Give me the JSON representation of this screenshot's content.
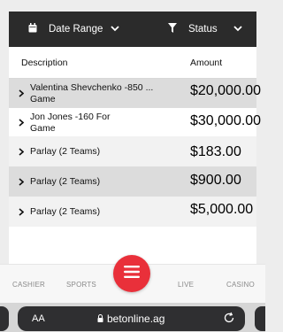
{
  "filters": {
    "date_range_label": "Date Range",
    "status_label": "Status",
    "calendar_icon": "calendar-icon",
    "filter_icon": "filter-icon"
  },
  "table": {
    "header_description": "Description",
    "header_amount": "Amount",
    "rows": [
      {
        "description": "Valentina Shevchenko -850 ...",
        "description_line2": "Game",
        "amount": "$20,000.00"
      },
      {
        "description": "Jon Jones -160 For",
        "description_line2": "Game",
        "amount": "$30,000.00"
      },
      {
        "description": "Parlay (2 Teams)",
        "description_line2": "",
        "amount": "$183.00"
      },
      {
        "description": "Parlay (2 Teams)",
        "description_line2": "",
        "amount": "$900.00"
      },
      {
        "description": "Parlay (2 Teams)",
        "description_line2": "",
        "amount": "$5,000.00"
      }
    ]
  },
  "nav": {
    "cashier": "CASHIER",
    "sports": "SPORTS",
    "live": "LIVE",
    "casino": "CASINO",
    "menu_icon": "hamburger-menu-icon"
  },
  "browser": {
    "text_size": "AA",
    "url": "betonline.ag"
  },
  "colors": {
    "filter_bar": "#2b2b2b",
    "amount_badge": "#ffd21a",
    "fab": "#e9303a",
    "alt_row": "#dcdcdc"
  }
}
